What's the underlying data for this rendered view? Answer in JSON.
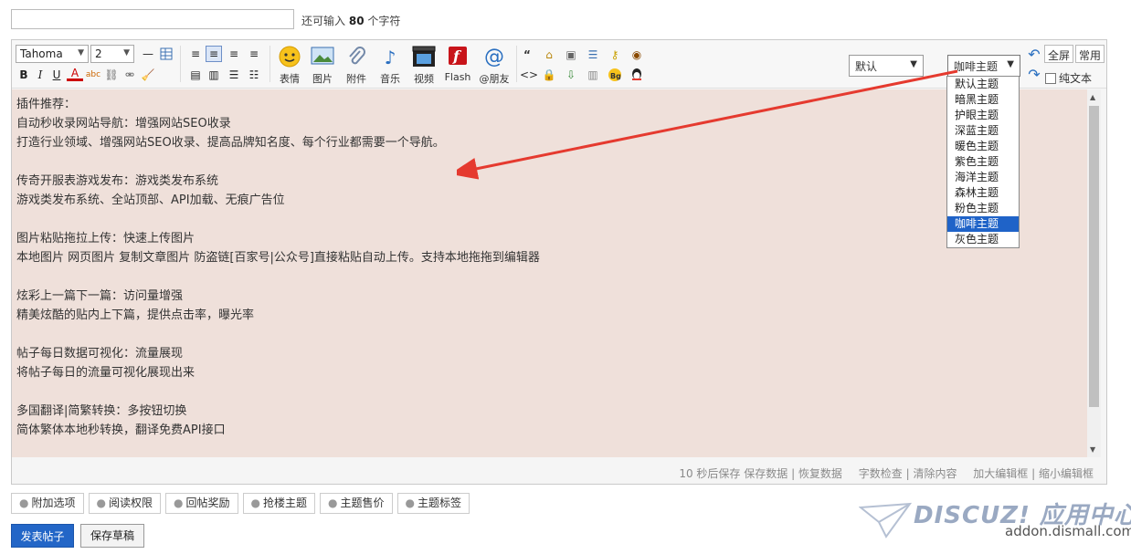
{
  "title_input": {
    "value": ""
  },
  "char_count": {
    "prefix": "还可输入",
    "count": "80",
    "suffix": "个字符"
  },
  "toolbar": {
    "font_family": "Tahoma",
    "font_size": "2",
    "big_buttons": [
      {
        "label": "表情",
        "icon": "emoji-icon"
      },
      {
        "label": "图片",
        "icon": "image-icon"
      },
      {
        "label": "附件",
        "icon": "attachment-icon"
      },
      {
        "label": "音乐",
        "icon": "music-icon"
      },
      {
        "label": "视频",
        "icon": "video-icon"
      },
      {
        "label": "Flash",
        "icon": "flash-icon"
      },
      {
        "label": "@朋友",
        "icon": "at-friend-icon"
      }
    ],
    "theme_default": "默认",
    "theme_current": "咖啡主题",
    "fullscreen": "全屏",
    "common": "常用",
    "plaintext": "纯文本"
  },
  "theme_options": [
    "默认主题",
    "暗黑主题",
    "护眼主题",
    "深蓝主题",
    "暖色主题",
    "紫色主题",
    "海洋主题",
    "森林主题",
    "粉色主题",
    "咖啡主题",
    "灰色主题"
  ],
  "content_lines": [
    "插件推荐：",
    "自动秒收录网站导航：增强网站SEO收录",
    "打造行业领域、增强网站SEO收录、提高品牌知名度、每个行业都需要一个导航。",
    "",
    "传奇开服表游戏发布：游戏类发布系统",
    "游戏类发布系统、全站顶部、API加载、无痕广告位",
    "",
    "图片粘贴拖拉上传：快速上传图片",
    "本地图片 网页图片 复制文章图片 防盗链[百家号|公众号]直接粘贴自动上传。支持本地拖拖到编辑器",
    "",
    "炫彩上一篇下一篇：访问量增强",
    "精美炫酷的贴内上下篇，提供点击率，曝光率",
    "",
    "帖子每日数据可视化：流量展现",
    "将帖子每日的流量可视化展现出来",
    "",
    "多国翻译|简繁转换：多按钮切换",
    "简体繁体本地秒转换，翻译免费API接口"
  ],
  "status": {
    "autosave": "10 秒后保存",
    "save_data": "保存数据",
    "restore_data": "恢复数据",
    "word_check": "字数检查",
    "clear_content": "清除内容",
    "enlarge": "加大编辑框",
    "shrink": "缩小编辑框"
  },
  "options": [
    "附加选项",
    "阅读权限",
    "回帖奖励",
    "抢楼主题",
    "主题售价",
    "主题标签"
  ],
  "actions": {
    "publish": "发表帖子",
    "draft": "保存草稿"
  },
  "watermark": {
    "brand": "DISCUZ! 应用中心",
    "url": "addon.dismall.com"
  },
  "colors": {
    "content_bg": "#efe0da",
    "accent": "#2366c7",
    "arrow": "#e53a2f"
  }
}
